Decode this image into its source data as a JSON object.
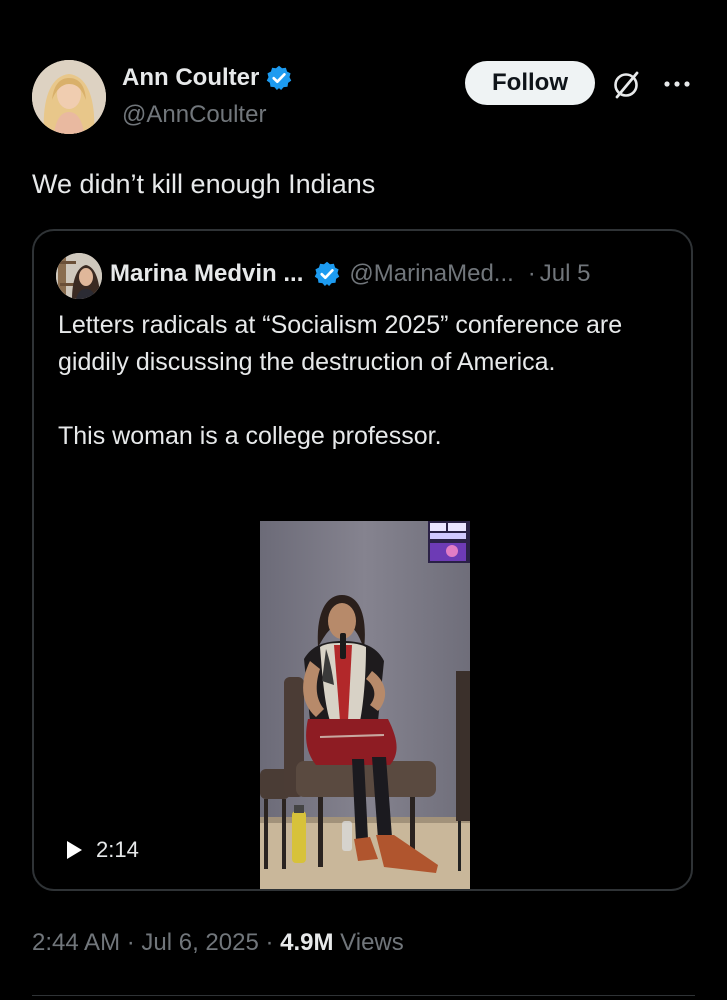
{
  "author": {
    "name": "Ann Coulter",
    "handle": "@AnnCoulter",
    "verified": true
  },
  "actions": {
    "follow_label": "Follow",
    "grok_icon": "grok-icon",
    "more_icon": "more-icon"
  },
  "tweet": {
    "text": "We didn’t kill enough Indians"
  },
  "quote": {
    "name": "Marina Medvin ...",
    "handle": "@MarinaMed...",
    "separator": "·",
    "date": "Jul 5",
    "paragraph1": "Letters radicals at “Socialism 2025” conference are giddily discussing the destruction of America.",
    "paragraph2": "This woman is a college professor.",
    "video": {
      "duration": "2:14",
      "play_icon": "play-icon"
    }
  },
  "meta": {
    "time": "2:44 AM",
    "sep1": " · ",
    "date": "Jul 6, 2025",
    "sep2": " · ",
    "views_count": "4.9M",
    "views_label": " Views"
  },
  "colors": {
    "background": "#000000",
    "text_primary": "#e7e9ea",
    "text_secondary": "#71767b",
    "border": "#2f3336",
    "verified_blue": "#1d9bf0",
    "follow_bg": "#eff3f4"
  }
}
